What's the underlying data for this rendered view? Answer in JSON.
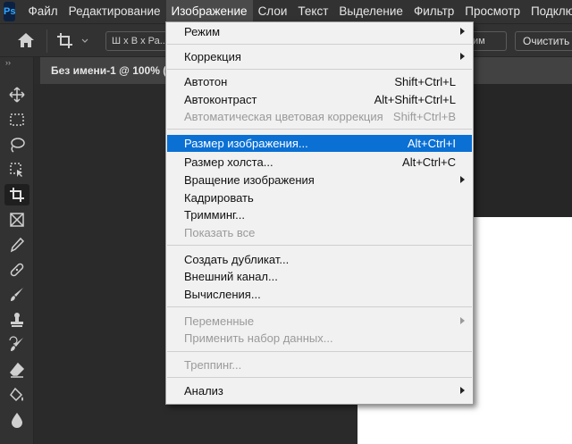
{
  "app": {
    "logo": "Ps"
  },
  "menubar": {
    "items": [
      "Файл",
      "Редактирование",
      "Изображение",
      "Слои",
      "Текст",
      "Выделение",
      "Фильтр",
      "Просмотр",
      "Подключа"
    ]
  },
  "options": {
    "ratio_value": "Ш x В x Ра...",
    "right_select_value": "им",
    "clear_label": "Очистить"
  },
  "document": {
    "tab_title": "Без имени-1 @ 100% ("
  },
  "dropdown": {
    "items": [
      {
        "label": "Режим",
        "shortcut": "",
        "submenu": true,
        "disabled": false
      },
      {
        "label": "Коррекция",
        "shortcut": "",
        "submenu": true,
        "disabled": false
      },
      {
        "label": "Автотон",
        "shortcut": "Shift+Ctrl+L",
        "submenu": false,
        "disabled": false
      },
      {
        "label": "Автоконтраст",
        "shortcut": "Alt+Shift+Ctrl+L",
        "submenu": false,
        "disabled": false
      },
      {
        "label": "Автоматическая цветовая коррекция",
        "shortcut": "Shift+Ctrl+B",
        "submenu": false,
        "disabled": true
      },
      {
        "label": "Размер изображения...",
        "shortcut": "Alt+Ctrl+I",
        "submenu": false,
        "disabled": false,
        "highlighted": true
      },
      {
        "label": "Размер холста...",
        "shortcut": "Alt+Ctrl+C",
        "submenu": false,
        "disabled": false
      },
      {
        "label": "Вращение изображения",
        "shortcut": "",
        "submenu": true,
        "disabled": false
      },
      {
        "label": "Кадрировать",
        "shortcut": "",
        "submenu": false,
        "disabled": false
      },
      {
        "label": "Тримминг...",
        "shortcut": "",
        "submenu": false,
        "disabled": false
      },
      {
        "label": "Показать все",
        "shortcut": "",
        "submenu": false,
        "disabled": true
      },
      {
        "label": "Создать дубликат...",
        "shortcut": "",
        "submenu": false,
        "disabled": false
      },
      {
        "label": "Внешний канал...",
        "shortcut": "",
        "submenu": false,
        "disabled": false
      },
      {
        "label": "Вычисления...",
        "shortcut": "",
        "submenu": false,
        "disabled": false
      },
      {
        "label": "Переменные",
        "shortcut": "",
        "submenu": true,
        "disabled": true
      },
      {
        "label": "Применить набор данных...",
        "shortcut": "",
        "submenu": false,
        "disabled": true
      },
      {
        "label": "Треппинг...",
        "shortcut": "",
        "submenu": false,
        "disabled": true
      },
      {
        "label": "Анализ",
        "shortcut": "",
        "submenu": true,
        "disabled": false
      }
    ]
  },
  "tools": [
    "move-tool",
    "marquee-tool",
    "lasso-tool",
    "object-select-tool",
    "crop-tool",
    "frame-tool",
    "eyedropper-tool",
    "healing-brush-tool",
    "brush-tool",
    "clone-stamp-tool",
    "history-brush-tool",
    "eraser-tool",
    "paint-bucket-tool",
    "blur-tool"
  ],
  "colors": {
    "highlight": "#0a70d4",
    "menu_bg": "#f1f1f1",
    "chrome": "#323232"
  }
}
